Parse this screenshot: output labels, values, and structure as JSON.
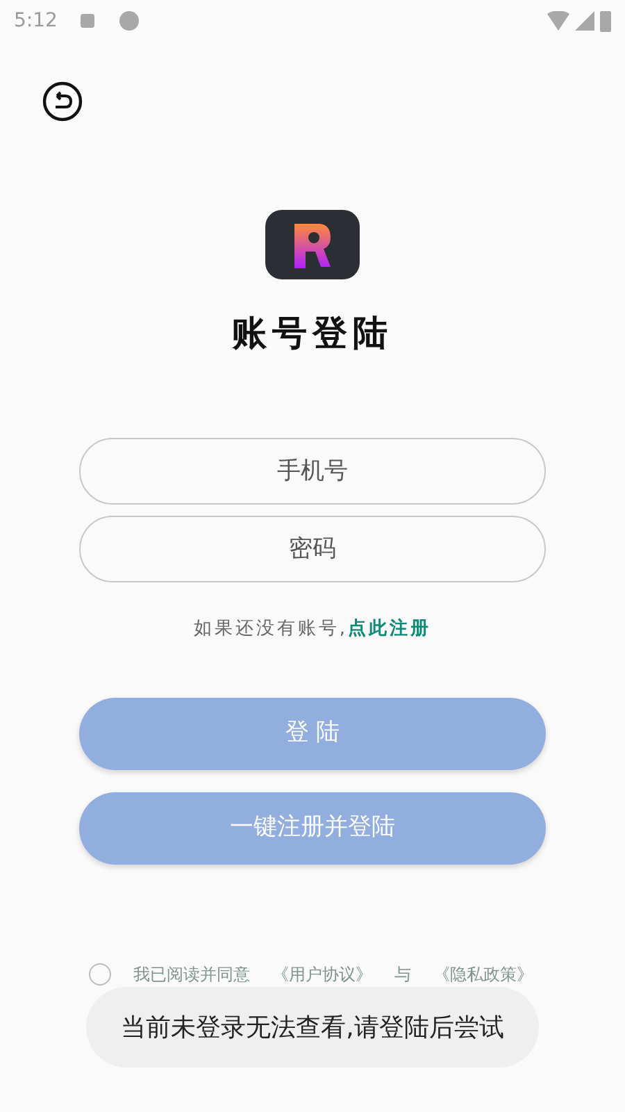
{
  "status_bar": {
    "time": "5:12"
  },
  "title": "账号登陆",
  "fields": [
    {
      "placeholder": "手机号"
    },
    {
      "placeholder": "密码"
    }
  ],
  "register_hint": {
    "text": "如果还没有账号,",
    "link": "点此注册"
  },
  "buttons": [
    "登 陆",
    "一键注册并登陆"
  ],
  "agreement": {
    "checked": false,
    "text": "我已阅读并同意",
    "links": [
      "《用户协议》",
      "《隐私政策》"
    ],
    "joiner": "与"
  },
  "toast": "当前未登录无法查看,请登陆后尝试"
}
